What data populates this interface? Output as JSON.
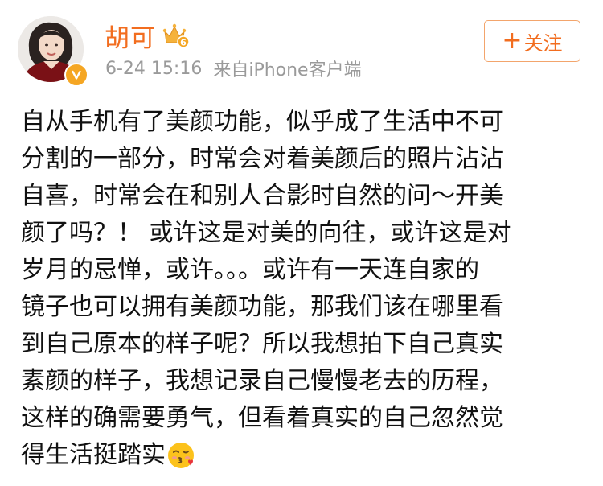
{
  "user": {
    "name": "胡可",
    "vip_icon": "crown-vip-icon",
    "verified_icon": "verified-v-icon"
  },
  "meta": {
    "time": "6-24 15:16",
    "source": "来自iPhone客户端"
  },
  "follow_button": {
    "plus": "+",
    "label": "关注"
  },
  "post": {
    "lines": [
      "自从手机有了美颜功能，似乎成了生活中不可",
      "分割的一部分，时常会对着美颜后的照片沾沾",
      "自喜，时常会在和别人合影时自然的问～开美",
      "颜了吗？！ 或许这是对美的向往，或许这是对",
      "岁月的忌惮，或许。。。或许有一天连自家的",
      "镜子也可以拥有美颜功能，那我们该在哪里看",
      "到自己原本的样子呢？所以我想拍下自己真实",
      "素颜的样子，我想记录自己慢慢老去的历程，",
      "这样的确需要勇气，但看着真实的自己忽然觉",
      "得生活挺踏实"
    ],
    "end_emoji": "kiss-emoji"
  },
  "colors": {
    "username": "#f26d1f",
    "meta": "#9a9a9a",
    "follow_border": "#f3a56c",
    "body_text": "#111111"
  }
}
